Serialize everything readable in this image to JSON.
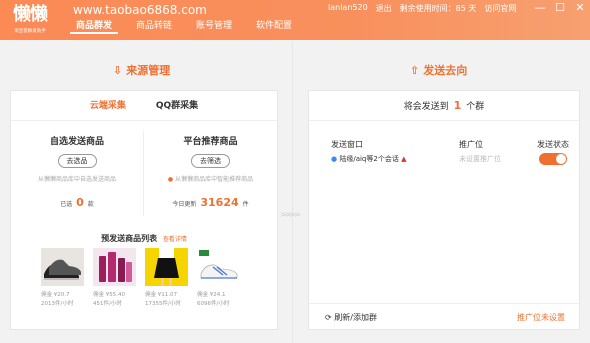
{
  "header": {
    "logo_text": "懒懒",
    "logo_sub": "淘宝客群发助手",
    "site_url": "www.taobao6868.com",
    "nav": [
      "商品群发",
      "商品转链",
      "账号管理",
      "软件配置"
    ],
    "username": "lanlan520",
    "logout": "退出",
    "days_left": "剩余使用时间：85 天",
    "official_site": "访问官网",
    "win_min": "—",
    "win_max": "☐",
    "win_close": "✕"
  },
  "source": {
    "title": "来源管理",
    "arrow": "⇩",
    "tabs": [
      "云端采集",
      "QQ群采集"
    ],
    "custom": {
      "title": "自选发送商品",
      "button": "去选品",
      "note": "从懒懒商品库中自选发送商品",
      "count_prefix": "已选",
      "count": "0",
      "count_suffix": "款"
    },
    "platform": {
      "title": "平台推荐商品",
      "button": "去筛选",
      "note": "从懒懒商品库中智能推荐商品",
      "count_prefix": "今日更新",
      "count": "31624",
      "count_suffix": "件"
    },
    "products_title": "预发送商品列表",
    "products_more": "查看详情",
    "products": [
      {
        "price": "佣金 ¥20.7",
        "sold": "2013件/小时"
      },
      {
        "price": "佣金 ¥55.40",
        "sold": "451件/小时"
      },
      {
        "price": "佣金 ¥11.07",
        "sold": "17355件/小时"
      },
      {
        "price": "佣金 ¥24.1",
        "sold": "6096件/小时"
      }
    ]
  },
  "destination": {
    "title": "发送去向",
    "arrow": "⇧",
    "head_prefix": "将会发送到",
    "head_count": "1",
    "head_suffix": "个群",
    "col_window": "发送窗口",
    "col_promo": "推广位",
    "col_status": "发送状态",
    "window_value": "陆缘/aiq等2个会话",
    "promo_value": "未设置推广位",
    "status_on": true,
    "refresh": "刷新/添加群",
    "promo_unset": "推广位未设置"
  },
  "colors": {
    "accent": "#f07030",
    "header_start": "#fb8a55",
    "header_end": "#f7a070"
  }
}
